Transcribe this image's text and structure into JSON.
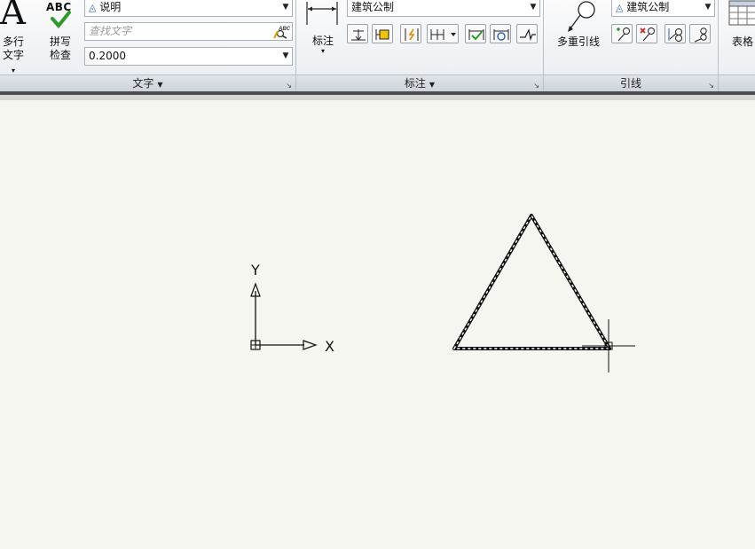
{
  "ribbon": {
    "text_panel": {
      "mtext_line1": "多行",
      "mtext_line2": "文字",
      "abc_label": "ABC",
      "spell_line1": "拼写",
      "spell_line2": "检查",
      "style_value": "说明",
      "find_placeholder": "查找文字",
      "height_value": "0.2000",
      "footer": "文字"
    },
    "dim_panel": {
      "dim_label": "标注",
      "style_value": "建筑公制",
      "footer": "标注"
    },
    "leader_panel": {
      "mleader_label": "多重引线",
      "style_value": "建筑公制",
      "footer": "引线"
    },
    "table_panel": {
      "table_label": "表格"
    }
  },
  "canvas": {
    "background": "#f6f6f0",
    "ucs_x_label": "X",
    "ucs_y_label": "Y"
  }
}
